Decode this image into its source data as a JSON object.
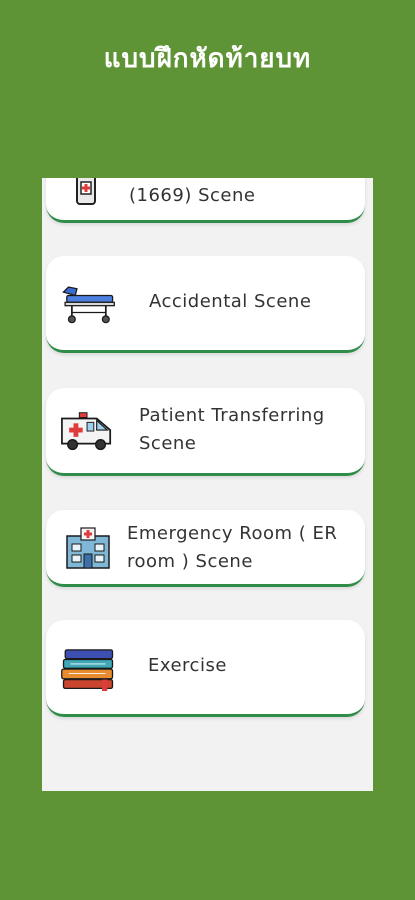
{
  "header": {
    "title": "แบบฝึกหัดท้ายบท"
  },
  "menu": {
    "items": [
      {
        "label": "(1669) Scene",
        "icon": "phone-medical-icon"
      },
      {
        "label": "Accidental Scene",
        "icon": "stretcher-icon"
      },
      {
        "label": "Patient Transferring Scene",
        "icon": "ambulance-icon"
      },
      {
        "label": "Emergency Room ( ER room ) Scene",
        "icon": "hospital-icon"
      },
      {
        "label": "Exercise",
        "icon": "books-icon"
      }
    ]
  },
  "colors": {
    "background": "#5e9435",
    "card_accent": "#2f8d49"
  }
}
